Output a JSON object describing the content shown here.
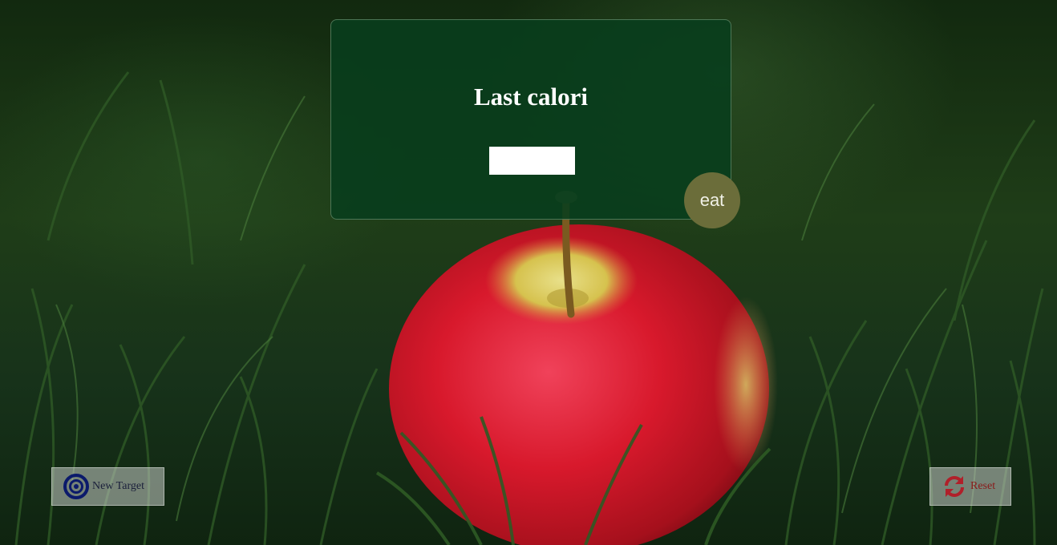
{
  "panel": {
    "title": "Last calori",
    "input_value": ""
  },
  "buttons": {
    "eat_label": "eat",
    "new_target_label": "New Target",
    "reset_label": "Reset"
  },
  "icons": {
    "new_target": "bullseye-icon",
    "reset": "refresh-icon"
  },
  "colors": {
    "panel_bg": "#083e1c",
    "eat_button": "#6b6d3a",
    "target_icon": "#0b1a6b",
    "reset_icon": "#b0202a"
  }
}
